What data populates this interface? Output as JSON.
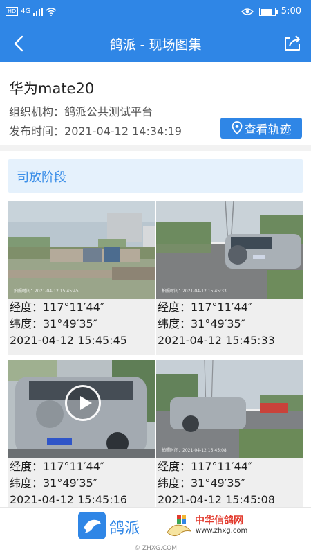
{
  "status_bar": {
    "hd": "HD",
    "signal": "4G",
    "time": "5:00",
    "battery_percent": 85
  },
  "nav": {
    "title": "鸽派 - 现场图集",
    "back_icon": "chevron-left-icon",
    "share_icon": "share-icon"
  },
  "device": {
    "name": "华为mate20",
    "org_label": "组织机构：",
    "org_value": "鸽派公共测试平台",
    "time_label": "发布时间：",
    "time_value": "2021-04-12 14:34:19",
    "track_button": "查看轨迹"
  },
  "stage": {
    "title": "司放阶段"
  },
  "photos": [
    {
      "lng": "经度：117°11′44″",
      "lat": "纬度：31°49′35″",
      "time": "2021-04-12 15:45:45",
      "stamp": "拍照时间：2021-04-12 15:45:45",
      "is_video": false
    },
    {
      "lng": "经度：117°11′44″",
      "lat": "纬度：31°49′35″",
      "time": "2021-04-12 15:45:33",
      "stamp": "拍照时间：2021-04-12 15:45:33",
      "is_video": false
    },
    {
      "lng": "经度：117°11′44″",
      "lat": "纬度：31°49′35″",
      "time": "2021-04-12 15:45:16",
      "stamp": "",
      "is_video": true
    },
    {
      "lng": "经度：117°11′44″",
      "lat": "纬度：31°49′35″",
      "time": "2021-04-12 15:45:08",
      "stamp": "拍照时间：2021-04-12 15:45:08",
      "is_video": false
    }
  ],
  "footer": {
    "logo1_text": "鸽派",
    "logo2_text": "中华信鸽网",
    "logo2_sub": "www.zhxg.com",
    "watermark": "© ZHXG.COM"
  },
  "colors": {
    "primary": "#2f86e6",
    "stage_bg": "#e5f1fc",
    "stage_text": "#3a8ee8",
    "brand_red": "#e23a2d"
  }
}
